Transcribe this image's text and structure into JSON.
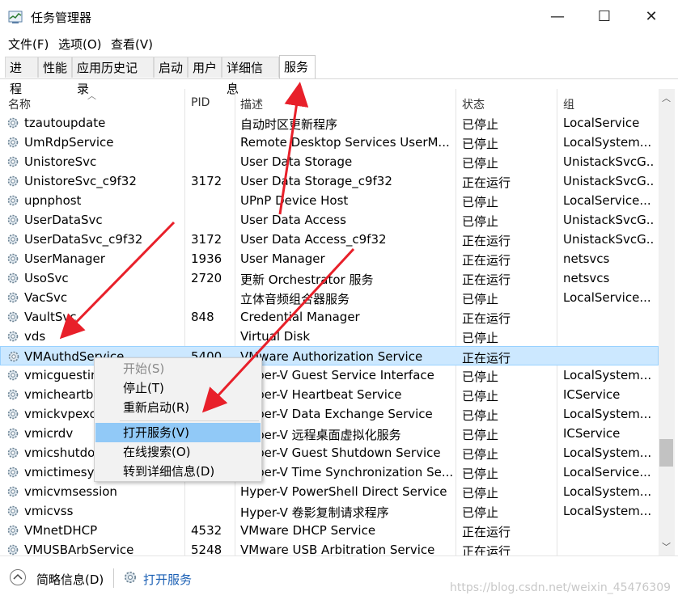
{
  "window": {
    "title": "任务管理器",
    "minimize": "—",
    "maximize": "☐",
    "close": "✕"
  },
  "menu": [
    "文件(F)",
    "选项(O)",
    "查看(V)"
  ],
  "tabs": [
    "进程",
    "性能",
    "应用历史记录",
    "启动",
    "用户",
    "详细信息",
    "服务"
  ],
  "active_tab": "服务",
  "columns": [
    "名称",
    "PID",
    "描述",
    "状态",
    "组"
  ],
  "rows": [
    {
      "name": "tzautoupdate",
      "pid": "",
      "desc": "自动时区更新程序",
      "status": "已停止",
      "group": "LocalService"
    },
    {
      "name": "UmRdpService",
      "pid": "",
      "desc": "Remote Desktop Services UserM...",
      "status": "已停止",
      "group": "LocalSystem..."
    },
    {
      "name": "UnistoreSvc",
      "pid": "",
      "desc": "User Data Storage",
      "status": "已停止",
      "group": "UnistackSvcG..."
    },
    {
      "name": "UnistoreSvc_c9f32",
      "pid": "3172",
      "desc": "User Data Storage_c9f32",
      "status": "正在运行",
      "group": "UnistackSvcG..."
    },
    {
      "name": "upnphost",
      "pid": "",
      "desc": "UPnP Device Host",
      "status": "已停止",
      "group": "LocalService..."
    },
    {
      "name": "UserDataSvc",
      "pid": "",
      "desc": "User Data Access",
      "status": "已停止",
      "group": "UnistackSvcG..."
    },
    {
      "name": "UserDataSvc_c9f32",
      "pid": "3172",
      "desc": "User Data Access_c9f32",
      "status": "正在运行",
      "group": "UnistackSvcG..."
    },
    {
      "name": "UserManager",
      "pid": "1936",
      "desc": "User Manager",
      "status": "正在运行",
      "group": "netsvcs"
    },
    {
      "name": "UsoSvc",
      "pid": "2720",
      "desc": "更新 Orchestrator 服务",
      "status": "正在运行",
      "group": "netsvcs"
    },
    {
      "name": "VacSvc",
      "pid": "",
      "desc": "立体音频组合器服务",
      "status": "已停止",
      "group": "LocalService..."
    },
    {
      "name": "VaultSvc",
      "pid": "848",
      "desc": "Credential Manager",
      "status": "正在运行",
      "group": ""
    },
    {
      "name": "vds",
      "pid": "",
      "desc": "Virtual Disk",
      "status": "已停止",
      "group": ""
    },
    {
      "name": "VMAuthdService",
      "pid": "5400",
      "desc": "VMware Authorization Service",
      "status": "正在运行",
      "group": ""
    },
    {
      "name": "vmicguestinterface",
      "pid": "",
      "desc": "Hyper-V Guest Service Interface",
      "status": "已停止",
      "group": "LocalSystem..."
    },
    {
      "name": "vmicheartbeat",
      "pid": "",
      "desc": "Hyper-V Heartbeat Service",
      "status": "已停止",
      "group": "ICService"
    },
    {
      "name": "vmickvpexchange",
      "pid": "",
      "desc": "Hyper-V Data Exchange Service",
      "status": "已停止",
      "group": "LocalSystem..."
    },
    {
      "name": "vmicrdv",
      "pid": "",
      "desc": "Hyper-V 远程桌面虚拟化服务",
      "status": "已停止",
      "group": "ICService"
    },
    {
      "name": "vmicshutdown",
      "pid": "",
      "desc": "Hyper-V Guest Shutdown Service",
      "status": "已停止",
      "group": "LocalSystem..."
    },
    {
      "name": "vmictimesync",
      "pid": "",
      "desc": "Hyper-V Time Synchronization Se...",
      "status": "已停止",
      "group": "LocalService..."
    },
    {
      "name": "vmicvmsession",
      "pid": "",
      "desc": "Hyper-V PowerShell Direct Service",
      "status": "已停止",
      "group": "LocalSystem..."
    },
    {
      "name": "vmicvss",
      "pid": "",
      "desc": "Hyper-V 卷影复制请求程序",
      "status": "已停止",
      "group": "LocalSystem..."
    },
    {
      "name": "VMnetDHCP",
      "pid": "4532",
      "desc": "VMware DHCP Service",
      "status": "正在运行",
      "group": ""
    },
    {
      "name": "VMUSBArbService",
      "pid": "5248",
      "desc": "VMware USB Arbitration Service",
      "status": "正在运行",
      "group": ""
    }
  ],
  "selected_row": "VMAuthdService",
  "context_menu": {
    "start": "开始(S)",
    "stop": "停止(T)",
    "restart": "重新启动(R)",
    "open_services": "打开服务(V)",
    "search_online": "在线搜索(O)",
    "go_to_details": "转到详细信息(D)"
  },
  "footer": {
    "fewer_details": "简略信息(D)",
    "open_services": "打开服务"
  },
  "watermark": "https://blog.csdn.net/weixin_45476309",
  "colors": {
    "selection": "#cce8ff",
    "menu_highlight": "#91c9f7",
    "arrow": "#e8202a",
    "link": "#1a5fb4"
  }
}
